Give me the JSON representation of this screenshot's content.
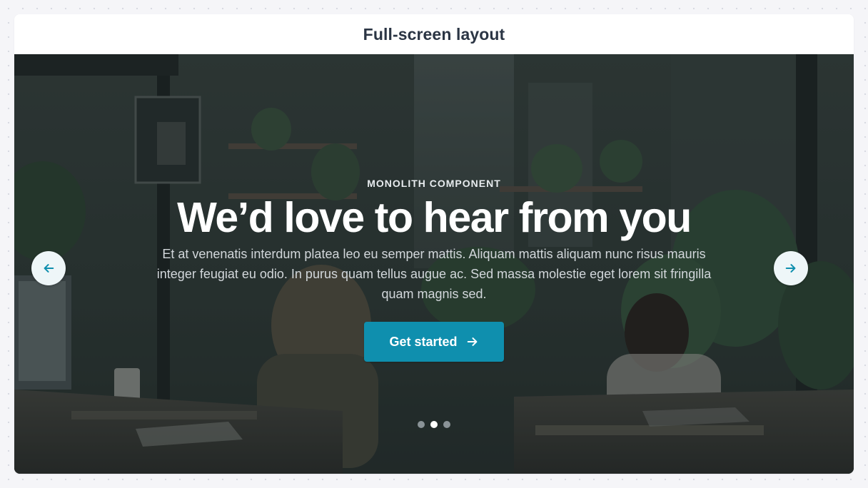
{
  "frame": {
    "title": "Full-screen layout"
  },
  "hero": {
    "eyebrow": "MONOLITH COMPONENT",
    "headline": "We’d love to hear from you",
    "subtext": "Et at venenatis interdum platea leo eu semper mattis. Aliquam mattis aliquam nunc risus mauris integer feugiat eu odio. In purus quam tellus augue ac. Sed massa molestie eget lorem sit fringilla quam magnis sed.",
    "cta_label": "Get started",
    "cta_icon": "arrow-right-icon",
    "prev_icon": "arrow-left-icon",
    "next_icon": "arrow-right-icon"
  },
  "carousel": {
    "slide_count": 3,
    "active_slide": 2
  },
  "colors": {
    "accent": "#0f8fae",
    "title_text": "#2b3544",
    "nav_button_bg": "#eef6f8"
  }
}
